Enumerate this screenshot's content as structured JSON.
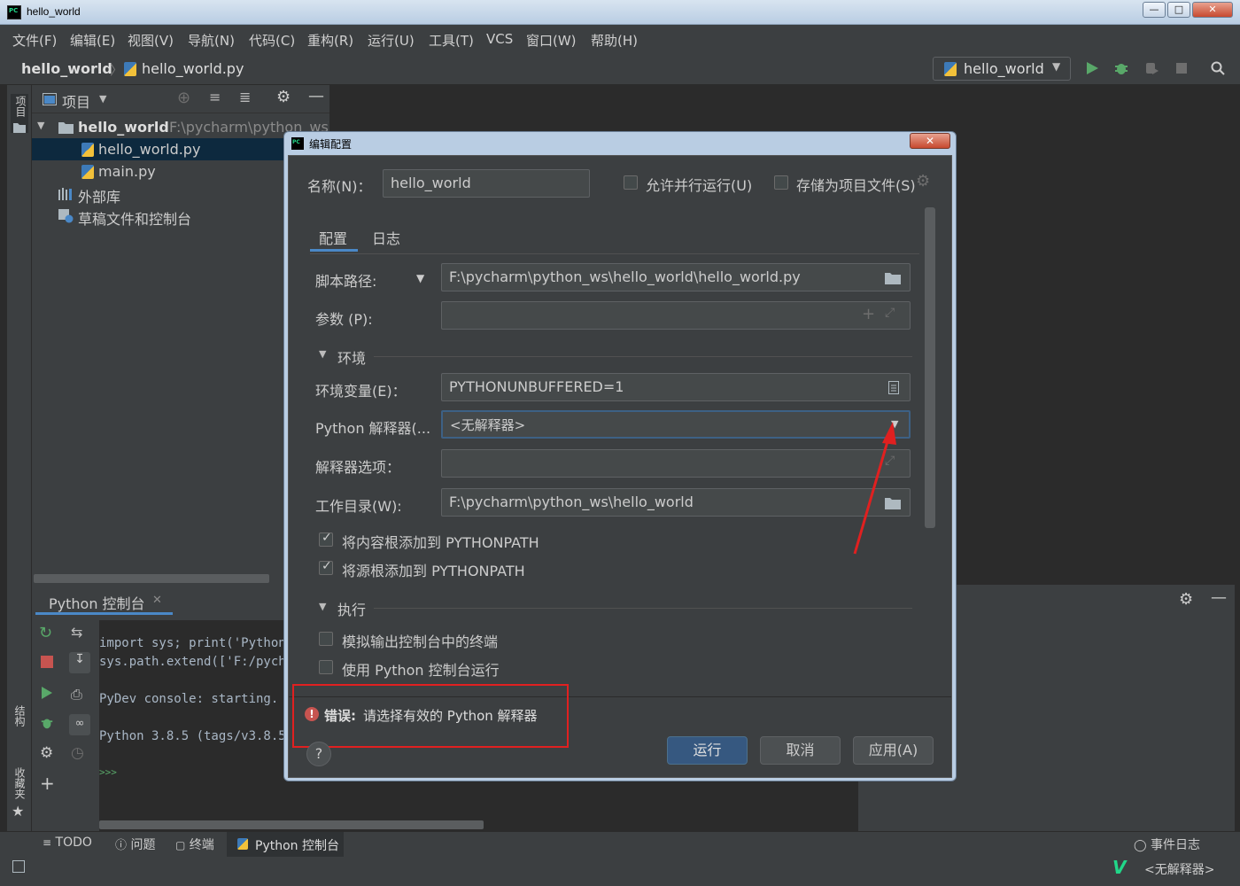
{
  "window": {
    "title": "hello_world"
  },
  "menu": [
    "文件(F)",
    "编辑(E)",
    "视图(V)",
    "导航(N)",
    "代码(C)",
    "重构(R)",
    "运行(U)",
    "工具(T)",
    "VCS",
    "窗口(W)",
    "帮助(H)"
  ],
  "nav": {
    "project": "hello_world",
    "file": "hello_world.py",
    "run_config": "hello_world"
  },
  "project_panel": {
    "tab_label": "项目",
    "header_label": "项目",
    "root": {
      "name": "hello_world",
      "path": "F:\\pycharm\\python_ws\\"
    },
    "files": [
      "hello_world.py",
      "main.py"
    ],
    "external_libs": "外部库",
    "scratches": "草稿文件和控制台"
  },
  "side_tabs": {
    "structure": "结构",
    "favorites": "收藏夹"
  },
  "console": {
    "tab": "Python 控制台",
    "lines": [
      "import sys; print('Python",
      "sys.path.extend(['F:/pycha",
      "",
      "PyDev console: starting.",
      "",
      "Python 3.8.5 (tags/v3.8.5:",
      "",
      ">>>"
    ]
  },
  "bottom_tabs": [
    "TODO",
    "问题",
    "终端",
    "Python 控制台"
  ],
  "status": {
    "event_log": "事件日志",
    "interpreter": "<无解释器>"
  },
  "dialog": {
    "title": "编辑配置",
    "name_label": "名称(N)：",
    "name_value": "hello_world",
    "allow_parallel": "允许并行运行(U)",
    "store_as_file": "存储为项目文件(S)",
    "tabs": [
      "配置",
      "日志"
    ],
    "script_path_label": "脚本路径:",
    "script_path_value": "F:\\pycharm\\python_ws\\hello_world\\hello_world.py",
    "params_label": "参数 (P):",
    "params_value": "",
    "env_section": "环境",
    "env_vars_label": "环境变量(E)：",
    "env_vars_value": "PYTHONUNBUFFERED=1",
    "interpreter_label": "Python 解释器(...",
    "interpreter_value": "<无解释器>",
    "interp_options_label": "解释器选项：",
    "interp_options_value": "",
    "workdir_label": "工作目录(W):",
    "workdir_value": "F:\\pycharm\\python_ws\\hello_world",
    "add_content_roots": "将内容根添加到 PYTHONPATH",
    "add_source_roots": "将源根添加到 PYTHONPATH",
    "exec_section": "执行",
    "emulate_terminal": "模拟输出控制台中的终端",
    "run_with_console": "使用 Python 控制台运行",
    "error_prefix": "错误:",
    "error_text": "请选择有效的 Python 解释器",
    "help": "?",
    "btn_run": "运行",
    "btn_cancel": "取消",
    "btn_apply": "应用(A)"
  }
}
